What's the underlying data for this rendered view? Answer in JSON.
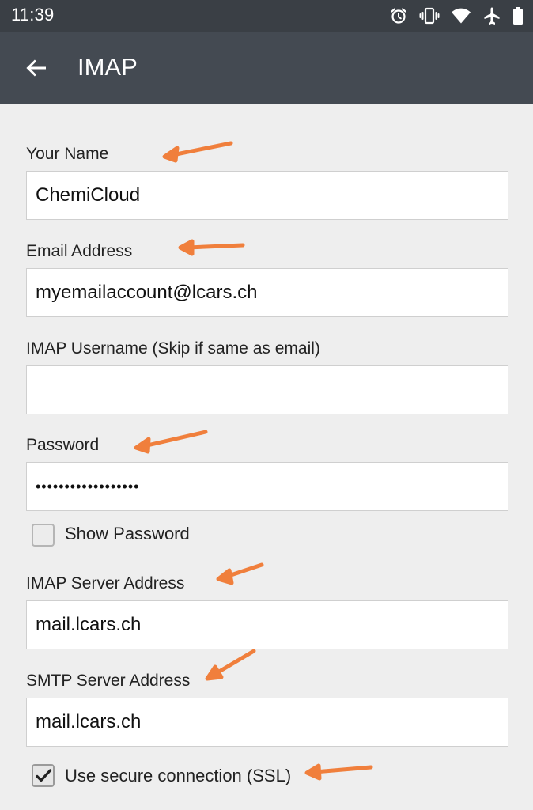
{
  "status_bar": {
    "time": "11:39",
    "icons": [
      "alarm-icon",
      "vibrate-icon",
      "wifi-icon",
      "airplane-icon",
      "battery-icon"
    ]
  },
  "app_bar": {
    "back_icon": "arrow-left-icon",
    "title": "IMAP"
  },
  "form": {
    "name": {
      "label": "Your Name",
      "value": "ChemiCloud"
    },
    "email": {
      "label": "Email Address",
      "value": "myemailaccount@lcars.ch"
    },
    "username": {
      "label": "IMAP Username (Skip if same as email)",
      "value": ""
    },
    "password": {
      "label": "Password",
      "value": "••••••••••••••••••"
    },
    "show_password": {
      "label": "Show Password",
      "checked": false
    },
    "imap_server": {
      "label": "IMAP Server Address",
      "value": "mail.lcars.ch"
    },
    "smtp_server": {
      "label": "SMTP Server Address",
      "value": "mail.lcars.ch"
    },
    "ssl": {
      "label": "Use secure connection (SSL)",
      "checked": true
    }
  },
  "colors": {
    "status_bar": "#3a3f45",
    "app_bar": "#444a52",
    "background": "#eeeeee",
    "annotation_arrow": "#f07f3c"
  }
}
